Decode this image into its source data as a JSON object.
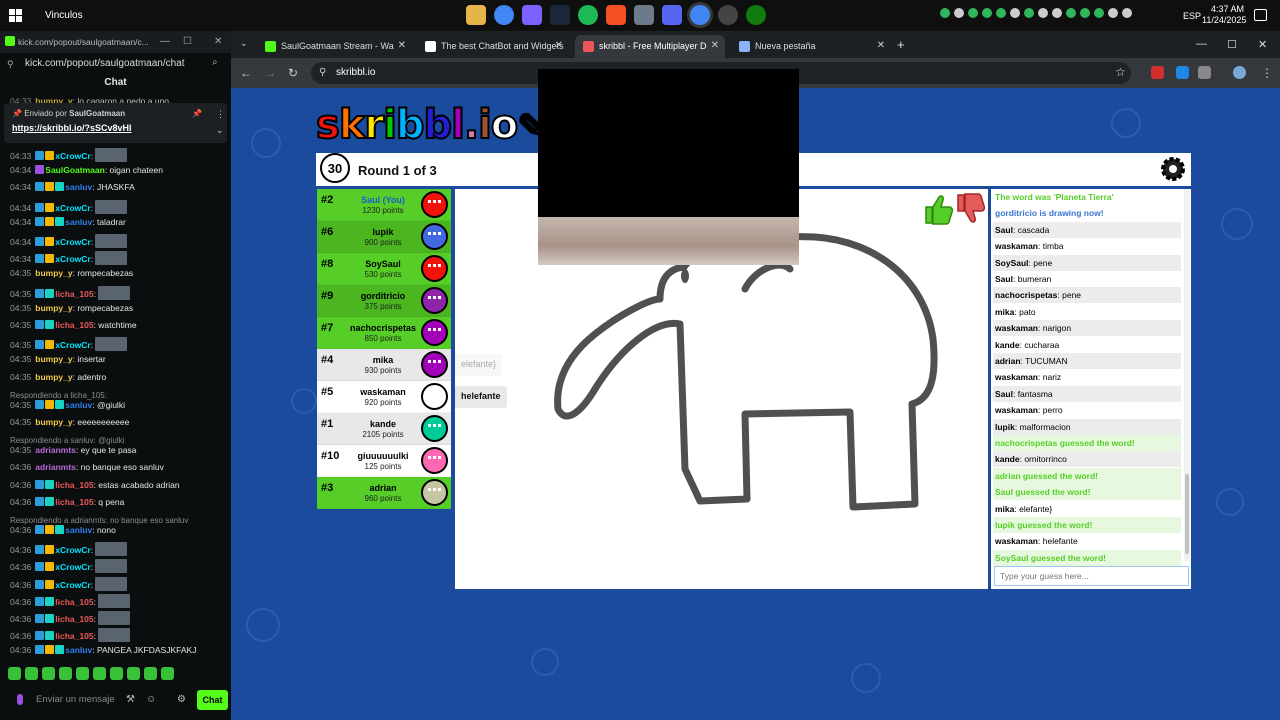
{
  "taskbar": {
    "title": "Vinculos",
    "lang": "ESP",
    "time": "4:37 AM",
    "date": "11/24/2025"
  },
  "kick": {
    "tab_title": "kick.com/popout/saulgoatmaan/c...",
    "url": "kick.com/popout/saulgoatmaan/chat",
    "chat_header": "Chat",
    "top_partial": {
      "ts": "04:33",
      "user": "bumpy_y",
      "text": "lo cagaron a pedo a uno"
    },
    "pinned": {
      "sent_by_label": "Enviado por",
      "sender": "SaulGoatmaan",
      "link": "https://skribbl.io/?sSCv8vHI"
    },
    "messages": [
      {
        "ts": "04:33",
        "badges": [
          "blue",
          "gold"
        ],
        "user": "xCrowCr",
        "color": "#00e5ff",
        "text": "",
        "emote": true
      },
      {
        "ts": "04:34",
        "badges": [
          "purple"
        ],
        "user": "SaulGoatmaan",
        "color": "#53fc18",
        "text": "oigan chateen",
        "emote": false
      },
      {
        "ts": "04:34",
        "badges": [
          "blue",
          "gold",
          "teal"
        ],
        "user": "sanluv",
        "color": "#2f80ed",
        "text": "JHASKFA",
        "emote": false
      },
      {
        "ts": "04:34",
        "badges": [
          "blue",
          "gold"
        ],
        "user": "xCrowCr",
        "color": "#00e5ff",
        "text": "",
        "emote": true
      },
      {
        "ts": "04:34",
        "badges": [
          "blue",
          "gold",
          "teal"
        ],
        "user": "sanluv",
        "color": "#2f80ed",
        "text": "taladrar",
        "emote": false
      },
      {
        "ts": "04:34",
        "badges": [
          "blue",
          "gold"
        ],
        "user": "xCrowCr",
        "color": "#00e5ff",
        "text": "",
        "emote": true
      },
      {
        "ts": "04:34",
        "badges": [
          "blue",
          "gold"
        ],
        "user": "xCrowCr",
        "color": "#00e5ff",
        "text": "",
        "emote": true
      },
      {
        "ts": "04:35",
        "badges": [],
        "user": "bumpy_y",
        "color": "#f2c94c",
        "text": "rompecabezas",
        "emote": false
      },
      {
        "ts": "04:35",
        "badges": [
          "blue",
          "teal"
        ],
        "user": "licha_105",
        "color": "#eb5757",
        "text": "",
        "emote": true
      },
      {
        "ts": "04:35",
        "badges": [],
        "user": "bumpy_y",
        "color": "#f2c94c",
        "text": "rompecabezas",
        "emote": false
      },
      {
        "ts": "04:35",
        "badges": [
          "blue",
          "teal"
        ],
        "user": "licha_105",
        "color": "#eb5757",
        "text": "watchtime",
        "emote": false
      },
      {
        "ts": "04:35",
        "badges": [
          "blue",
          "gold"
        ],
        "user": "xCrowCr",
        "color": "#00e5ff",
        "text": "",
        "emote": true
      },
      {
        "ts": "04:35",
        "badges": [],
        "user": "bumpy_y",
        "color": "#f2c94c",
        "text": "insertar",
        "emote": false
      },
      {
        "ts": "04:35",
        "badges": [],
        "user": "bumpy_y",
        "color": "#f2c94c",
        "text": "adentro",
        "emote": false
      },
      {
        "ts": "04:35",
        "badges": [
          "blue",
          "gold",
          "teal"
        ],
        "user": "sanluv",
        "color": "#2f80ed",
        "text": "@giulki",
        "emote": false,
        "reply": "Respondiendo a licha_105:"
      },
      {
        "ts": "04:35",
        "badges": [],
        "user": "bumpy_y",
        "color": "#f2c94c",
        "text": "eeeeeeeeeee",
        "emote": false
      },
      {
        "ts": "04:35",
        "badges": [],
        "user": "adrianmts",
        "color": "#bb6bd9",
        "text": "ey que te pasa",
        "emote": false,
        "reply": "Respondiendo a sanluv: @giulki"
      },
      {
        "ts": "04:36",
        "badges": [],
        "user": "adrianmts",
        "color": "#bb6bd9",
        "text": "no banque eso sanluv",
        "emote": false
      },
      {
        "ts": "04:36",
        "badges": [
          "blue",
          "teal"
        ],
        "user": "licha_105",
        "color": "#eb5757",
        "text": "estas acabado adrian",
        "emote": false
      },
      {
        "ts": "04:36",
        "badges": [
          "blue",
          "teal"
        ],
        "user": "licha_105",
        "color": "#eb5757",
        "text": "q pena",
        "emote": false
      },
      {
        "ts": "04:36",
        "badges": [
          "blue",
          "gold",
          "teal"
        ],
        "user": "sanluv",
        "color": "#2f80ed",
        "text": "nono",
        "emote": false,
        "reply": "Respondiendo a adrianmts: no banque eso sanluv"
      },
      {
        "ts": "04:36",
        "badges": [
          "blue",
          "gold"
        ],
        "user": "xCrowCr",
        "color": "#00e5ff",
        "text": "",
        "emote": true
      },
      {
        "ts": "04:36",
        "badges": [
          "blue",
          "gold"
        ],
        "user": "xCrowCr",
        "color": "#00e5ff",
        "text": "",
        "emote": true
      },
      {
        "ts": "04:36",
        "badges": [
          "blue",
          "gold"
        ],
        "user": "xCrowCr",
        "color": "#00e5ff",
        "text": "",
        "emote": true
      },
      {
        "ts": "04:36",
        "badges": [
          "blue",
          "teal"
        ],
        "user": "licha_105",
        "color": "#eb5757",
        "text": "",
        "emote": true
      },
      {
        "ts": "04:36",
        "badges": [
          "blue",
          "teal"
        ],
        "user": "licha_105",
        "color": "#eb5757",
        "text": "",
        "emote": true
      },
      {
        "ts": "04:36",
        "badges": [
          "blue",
          "teal"
        ],
        "user": "licha_105",
        "color": "#eb5757",
        "text": "",
        "emote": true
      },
      {
        "ts": "04:36",
        "badges": [
          "blue",
          "gold",
          "teal"
        ],
        "user": "sanluv",
        "color": "#2f80ed",
        "text": "PANGEA JKFDASJKFAKJ",
        "emote": false
      }
    ],
    "send_placeholder": "Enviar un mensaje",
    "chat_button": "Chat"
  },
  "chrome": {
    "tabs": [
      {
        "title": "SaulGoatmaan Stream - Wa",
        "fav": "#53fc18",
        "active": false
      },
      {
        "title": "The best ChatBot and Widgets",
        "fav": "#ffffff",
        "active": false
      },
      {
        "title": "skribbl - Free Multiplayer D",
        "fav": "#eb5757",
        "active": true
      },
      {
        "title": "Nueva pestaña",
        "fav": "#8ab4f8",
        "active": false
      }
    ],
    "url": "skribbl.io"
  },
  "game": {
    "logo": "skribbl.io",
    "logo_colors": [
      "#ef130b",
      "#ff7100",
      "#ffe400",
      "#00cc00",
      "#00b2ff",
      "#231fd3",
      "#a300ba",
      "#d37caa",
      "#a0522d",
      "#ffffff"
    ],
    "timer": "30",
    "round": "Round 1 of 3",
    "players": [
      {
        "rank": "#2",
        "name": "Saul (You)",
        "points": "1230 points",
        "bg": "#56ce27",
        "color": "#ef130b",
        "you": true
      },
      {
        "rank": "#6",
        "name": "lupik",
        "points": "900 points",
        "bg": "#4bb61f",
        "color": "#4169e1"
      },
      {
        "rank": "#8",
        "name": "SoySaul",
        "points": "530 points",
        "bg": "#56ce27",
        "color": "#ef130b"
      },
      {
        "rank": "#9",
        "name": "gorditricio",
        "points": "375 points",
        "bg": "#4bb61f",
        "color": "#8e24aa"
      },
      {
        "rank": "#7",
        "name": "nachocrispetas",
        "points": "850 points",
        "bg": "#56ce27",
        "color": "#a300ba"
      },
      {
        "rank": "#4",
        "name": "mika",
        "points": "930 points",
        "bg": "#e8e8e8",
        "color": "#a300ba"
      },
      {
        "rank": "#5",
        "name": "waskaman",
        "points": "920 points",
        "bg": "#ffffff",
        "color": "#ffffff"
      },
      {
        "rank": "#1",
        "name": "kande",
        "points": "2105 points",
        "bg": "#e8e8e8",
        "color": "#00cc99"
      },
      {
        "rank": "#10",
        "name": "giuuuuuulki",
        "points": "125 points",
        "bg": "#ffffff",
        "color": "#ff69b4"
      },
      {
        "rank": "#3",
        "name": "adrian",
        "points": "960 points",
        "bg": "#56ce27",
        "color": "#c6c6a4"
      }
    ],
    "hints": [
      {
        "text": "elefante}",
        "faded": true
      },
      {
        "text": "helefante",
        "faded": false
      }
    ],
    "chat": [
      {
        "type": "sys",
        "text": "The word was 'Planeta Tierra'"
      },
      {
        "type": "draw",
        "text": "gorditricio is drawing now!"
      },
      {
        "type": "msg",
        "user": "Saul",
        "text": "cascada"
      },
      {
        "type": "msg",
        "user": "waskaman",
        "text": "timba"
      },
      {
        "type": "msg",
        "user": "SoySaul",
        "text": "pene"
      },
      {
        "type": "msg",
        "user": "Saul",
        "text": "bumeran"
      },
      {
        "type": "msg",
        "user": "nachocrispetas",
        "text": "pene"
      },
      {
        "type": "msg",
        "user": "mika",
        "text": "pato"
      },
      {
        "type": "msg",
        "user": "waskaman",
        "text": "narigon"
      },
      {
        "type": "msg",
        "user": "kande",
        "text": "cucharaa"
      },
      {
        "type": "msg",
        "user": "adrian",
        "text": "TUCUMAN"
      },
      {
        "type": "msg",
        "user": "waskaman",
        "text": "nariz"
      },
      {
        "type": "msg",
        "user": "Saul",
        "text": "fantasma"
      },
      {
        "type": "msg",
        "user": "waskaman",
        "text": "perro"
      },
      {
        "type": "msg",
        "user": "lupik",
        "text": "malformacion"
      },
      {
        "type": "guess",
        "text": "nachocrispetas guessed the word!"
      },
      {
        "type": "msg",
        "user": "kande",
        "text": "ornitorrinco"
      },
      {
        "type": "guess",
        "text": "adrian guessed the word!"
      },
      {
        "type": "guess",
        "text": "Saul guessed the word!"
      },
      {
        "type": "msg",
        "user": "mika",
        "text": "elefante}"
      },
      {
        "type": "guess",
        "text": "lupik guessed the word!"
      },
      {
        "type": "msg",
        "user": "waskaman",
        "text": "helefante"
      },
      {
        "type": "guess",
        "text": "SoySaul guessed the word!"
      }
    ],
    "guess_placeholder": "Type your guess here..."
  }
}
